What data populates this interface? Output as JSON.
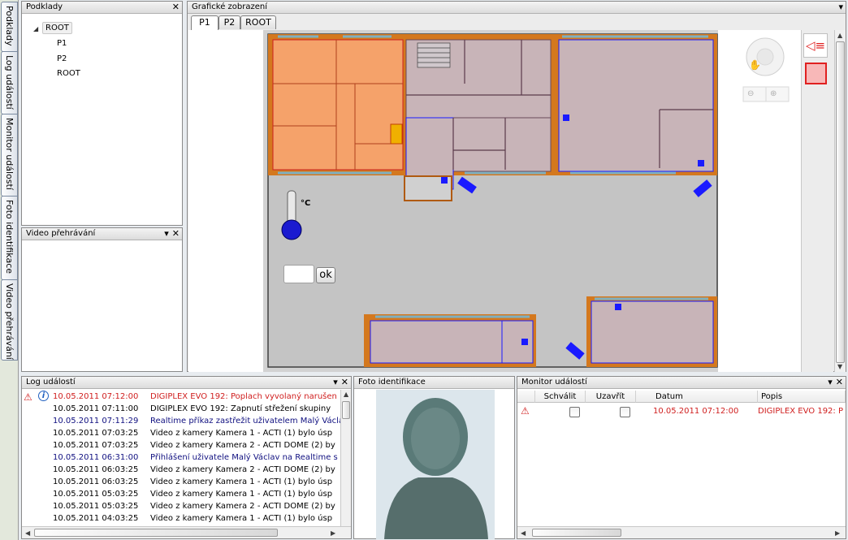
{
  "sidebar_tabs": [
    {
      "label": "Podklady"
    },
    {
      "label": "Log událostí"
    },
    {
      "label": "Monitor událostí"
    },
    {
      "label": "Foto identifikace"
    },
    {
      "label": "Video přehrávání"
    }
  ],
  "podklady": {
    "title": "Podklady",
    "close": "✕",
    "tree": [
      {
        "label": "ROOT",
        "expander": "◢"
      },
      {
        "label": "P1"
      },
      {
        "label": "P2"
      },
      {
        "label": "ROOT"
      }
    ]
  },
  "video": {
    "title": "Video přehrávání",
    "pin": "▾",
    "close": "✕"
  },
  "graphics": {
    "title": "Grafické zobrazení",
    "menu": "▾",
    "tabs": [
      {
        "label": "P1",
        "active": true
      },
      {
        "label": "P2"
      },
      {
        "label": "ROOT"
      }
    ],
    "temp_unit": "°C",
    "input_value": "",
    "ok_label": "ok"
  },
  "log": {
    "title": "Log událostí",
    "pin": "▾",
    "close": "✕",
    "rows": [
      {
        "date": "10.05.2011 07:12:00",
        "text": "DIGIPLEX EVO 192: Poplach vyvolaný narušen",
        "style": "red",
        "icons": [
          "warning",
          "info"
        ]
      },
      {
        "date": "10.05.2011 07:11:00",
        "text": "DIGIPLEX EVO 192: Zapnutí střežení skupiny",
        "style": "normal"
      },
      {
        "date": "10.05.2011 07:11:29",
        "text": "Realtime příkaz zastřežit uživatelem Malý Václav",
        "style": "blue"
      },
      {
        "date": "10.05.2011 07:03:25",
        "text": "Video z kamery Kamera 1 - ACTI (1) bylo úsp",
        "style": "normal"
      },
      {
        "date": "10.05.2011 07:03:25",
        "text": "Video z kamery Kamera 2 - ACTI DOME (2) by",
        "style": "normal"
      },
      {
        "date": "10.05.2011 06:31:00",
        "text": "Přihlášení uživatele Malý Václav na Realtime s",
        "style": "blue"
      },
      {
        "date": "10.05.2011 06:03:25",
        "text": "Video z kamery Kamera 2 - ACTI DOME (2) by",
        "style": "normal"
      },
      {
        "date": "10.05.2011 06:03:25",
        "text": "Video z kamery Kamera 1 - ACTI (1) bylo úsp",
        "style": "normal"
      },
      {
        "date": "10.05.2011 05:03:25",
        "text": "Video z kamery Kamera 1 - ACTI (1) bylo úsp",
        "style": "normal"
      },
      {
        "date": "10.05.2011 05:03:25",
        "text": "Video z kamery Kamera 2 - ACTI DOME (2) by",
        "style": "normal"
      },
      {
        "date": "10.05.2011 04:03:25",
        "text": "Video z kamery Kamera 1 - ACTI (1) bylo úsp",
        "style": "normal"
      }
    ]
  },
  "foto": {
    "title": "Foto identifikace"
  },
  "monitor": {
    "title": "Monitor událostí",
    "pin": "▾",
    "close": "✕",
    "columns": [
      "Schválit",
      "Uzavřít",
      "Datum",
      "Popis"
    ],
    "rows": [
      {
        "schvalit": false,
        "uzavrit": false,
        "datum": "10.05.2011 07:12:00",
        "popis": "DIGIPLEX EVO 192: P",
        "icon": "warning"
      }
    ]
  },
  "colors": {
    "alarm_zone": "#f5a26a",
    "zone": "#c8b4b8",
    "wall": "#d4781e",
    "accent_blue": "#1a1aff",
    "alarm_red": "#d02020"
  }
}
